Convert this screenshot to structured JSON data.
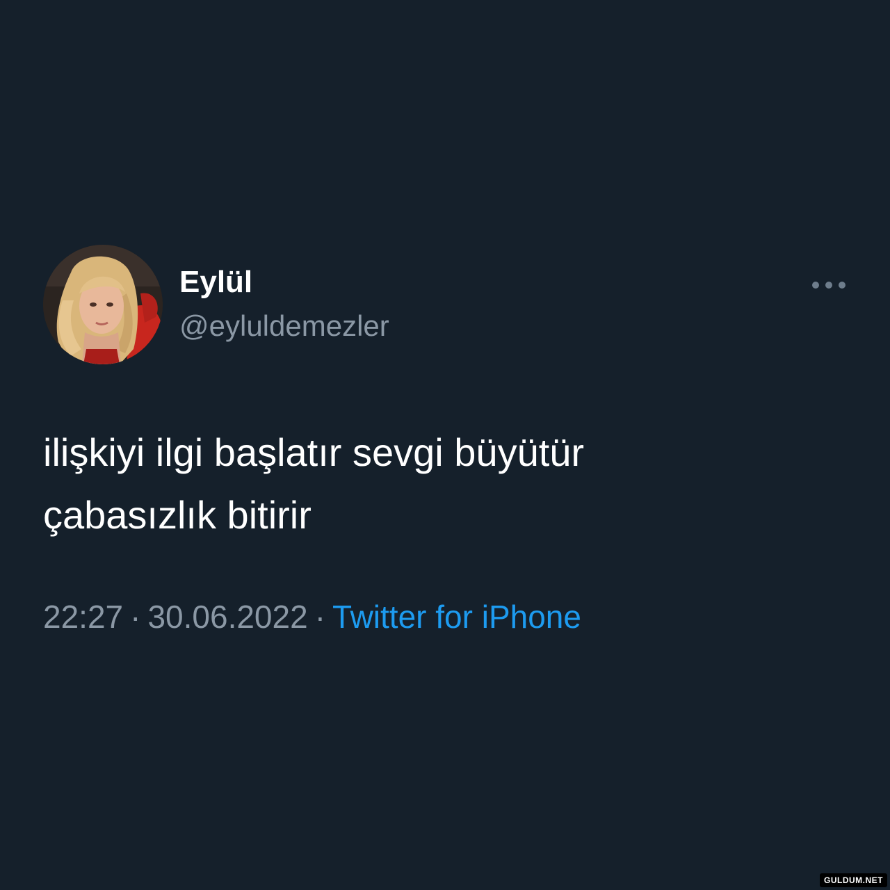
{
  "tweet": {
    "display_name": "Eylül",
    "handle": "@eyluldemezler",
    "text_lines": [
      "ilişkiyi ilgi başlatır sevgi büyütür",
      "çabasızlık bitirir"
    ],
    "time": "22:27",
    "separator": "·",
    "date": "30.06.2022",
    "source": "Twitter for iPhone",
    "avatar_icon": "profile-photo",
    "more_icon": "more-horizontal-icon"
  },
  "watermark": "GULDUM.NET",
  "colors": {
    "background": "#15202b",
    "text_primary": "#ffffff",
    "text_secondary": "#8b98a5",
    "accent": "#1d9bf0"
  }
}
